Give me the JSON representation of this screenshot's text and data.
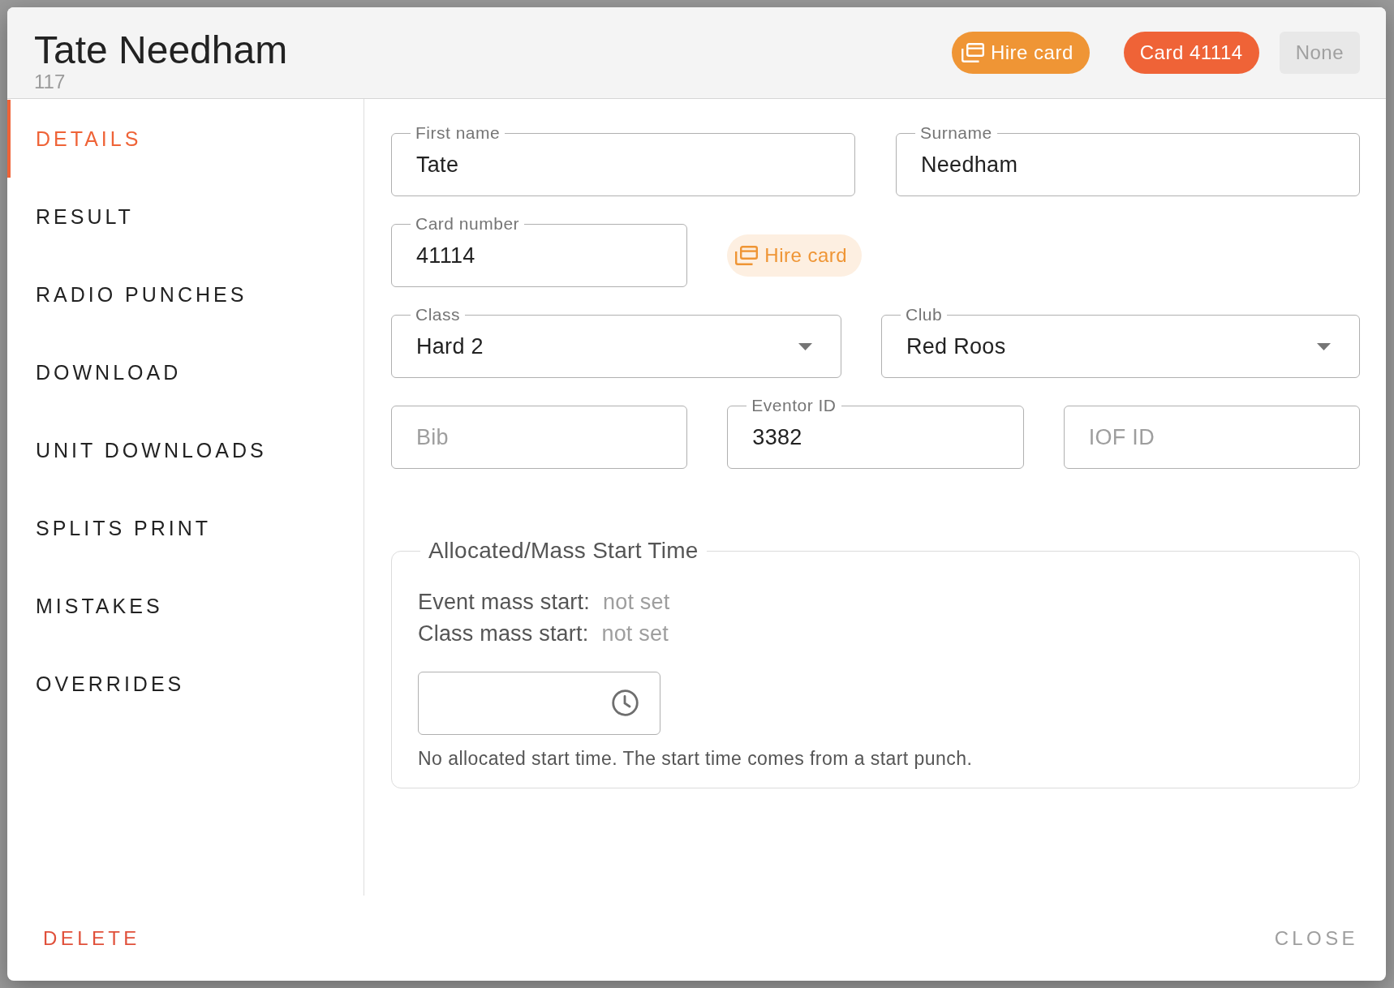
{
  "dialog": {
    "title": "Tate Needham",
    "subtitle": "117",
    "header_buttons": [
      {
        "label": "Hire card",
        "kind": "hire",
        "color": "#ef9535",
        "disabled": false
      },
      {
        "label": "Card 41114",
        "kind": "card",
        "color": "#ef6337",
        "disabled": false
      },
      {
        "label": "None",
        "kind": "card",
        "disabled": true
      }
    ]
  },
  "sidebar": {
    "items": [
      {
        "label": "DETAILS",
        "selected": true
      },
      {
        "label": "RESULT",
        "selected": false
      },
      {
        "label": "RADIO PUNCHES",
        "selected": false
      },
      {
        "label": "DOWNLOAD",
        "selected": false
      },
      {
        "label": "UNIT DOWNLOADS",
        "selected": false
      },
      {
        "label": "SPLITS PRINT",
        "selected": false
      },
      {
        "label": "MISTAKES",
        "selected": false
      },
      {
        "label": "OVERRIDES",
        "selected": false
      }
    ]
  },
  "form": {
    "first_name": {
      "label": "First name",
      "value": "Tate"
    },
    "surname": {
      "label": "Surname",
      "value": "Needham"
    },
    "card_number": {
      "label": "Card number",
      "value": "41114"
    },
    "hire_card_button": {
      "label": "Hire card"
    },
    "class": {
      "label": "Class",
      "value": "Hard 2"
    },
    "club": {
      "label": "Club",
      "value": "Red Roos"
    },
    "bib": {
      "placeholder": "Bib"
    },
    "eventor_id": {
      "label": "Eventor ID",
      "value": "3382"
    },
    "iof_id": {
      "placeholder": "IOF ID"
    }
  },
  "start_time": {
    "legend": "Allocated/Mass Start Time",
    "mass_starts": [
      {
        "label": "Event mass start:",
        "value": "not set"
      },
      {
        "label": "Class mass start:",
        "value": "not set"
      }
    ],
    "helper_text": "No allocated start time. The start time comes from a start punch."
  },
  "footer": {
    "delete_button": "DELETE",
    "close_button": "CLOSE"
  }
}
